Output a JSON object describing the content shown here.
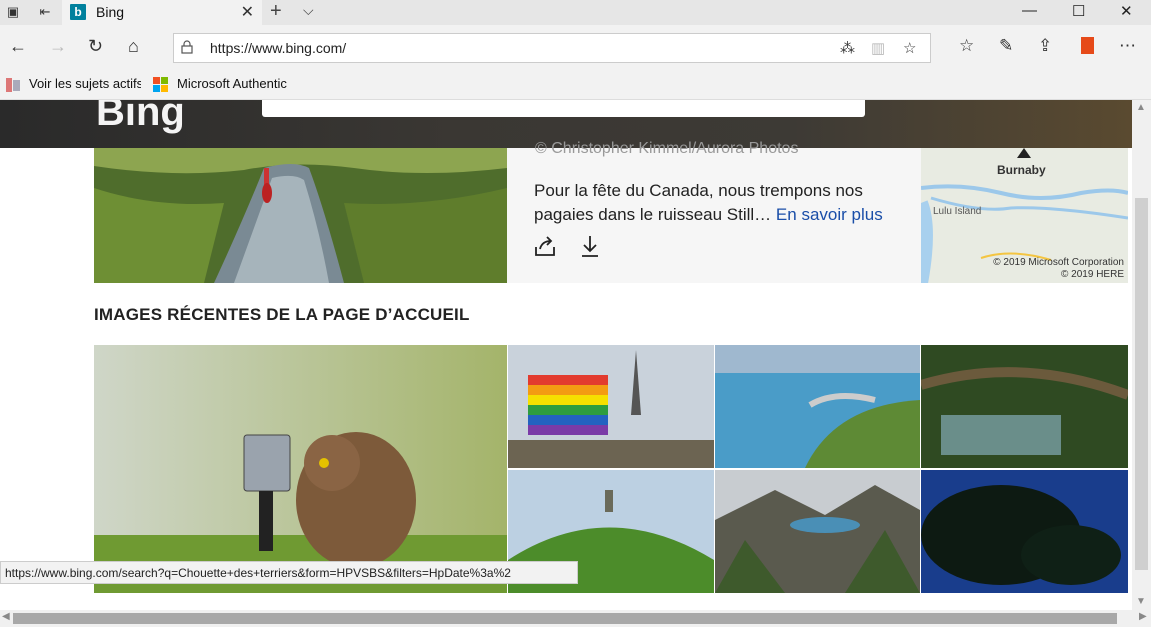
{
  "browser": {
    "tab_title": "Bing",
    "favicon_letter": "b",
    "url": "https://www.bing.com/",
    "favorites": [
      {
        "label": "Voir les sujets actifs"
      },
      {
        "label": "Microsoft Authentic"
      }
    ]
  },
  "hero": {
    "brand": "Bing",
    "credit": "© Christopher Kimmel/Aurora Photos",
    "description": "Pour la fête du Canada, nous trempons nos pagaies dans le ruisseau Still…",
    "learn_more": "En savoir plus",
    "map": {
      "city": "Burnaby",
      "island": "Lulu Island",
      "copyright_1": "© 2019 Microsoft Corporation",
      "copyright_2": "© 2019 HERE"
    }
  },
  "recent": {
    "title": "IMAGES RÉCENTES DE LA PAGE D’ACCUEIL"
  },
  "status_bar": {
    "url": "https://www.bing.com/search?q=Chouette+des+terriers&form=HPVSBS&filters=HpDate%3a%2"
  },
  "colors": {
    "accent": "#00809d",
    "link": "#1a4ea8",
    "office": "#e64a19"
  }
}
